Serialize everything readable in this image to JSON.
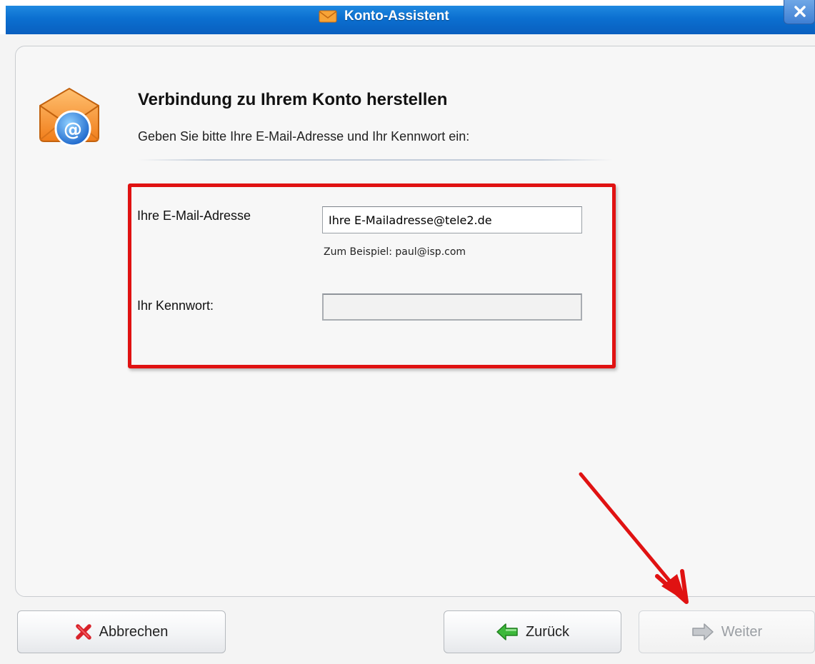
{
  "window": {
    "title": "Konto-Assistent",
    "close_icon": "close-icon"
  },
  "header": {
    "icon": "email-envelope-icon",
    "heading": "Verbindung zu Ihrem Konto herstellen",
    "subheading": "Geben Sie bitte Ihre E-Mail-Adresse und Ihr Kennwort ein:"
  },
  "form": {
    "email_label": "Ihre E-Mail-Adresse",
    "email_value": "Ihre E-Mailadresse@tele2.de",
    "example_hint": "Zum Beispiel: paul@isp.com",
    "password_label": "Ihr Kennwort:",
    "password_value": ""
  },
  "annotation": {
    "highlight_color": "#e01212",
    "arrow_color": "#e01212"
  },
  "buttons": {
    "cancel": {
      "label": "Abbrechen",
      "icon": "red-x-icon"
    },
    "back": {
      "label": "Zurück",
      "icon": "green-left-arrow-icon"
    },
    "next": {
      "label": "Weiter",
      "icon": "gray-right-arrow-icon",
      "enabled": false
    }
  }
}
